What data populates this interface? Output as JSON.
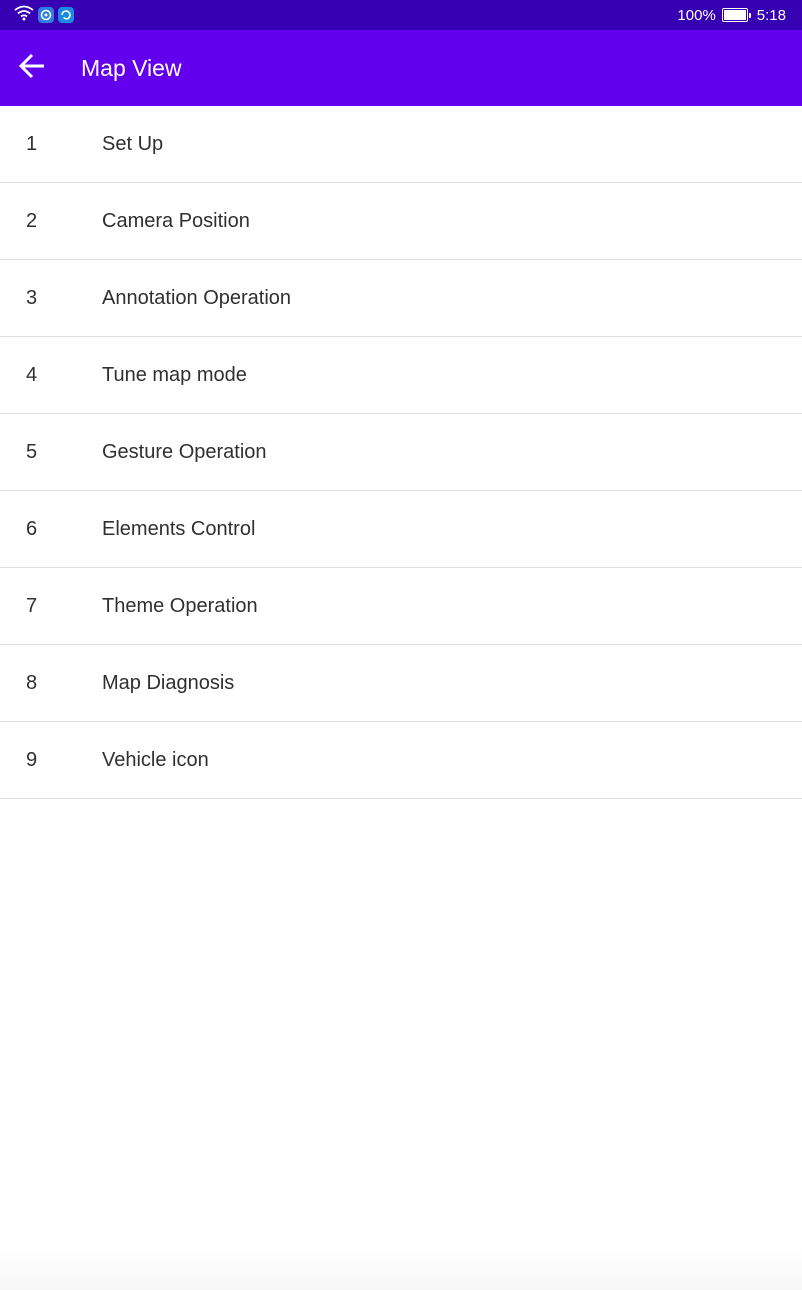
{
  "status_bar": {
    "battery": "100%",
    "time": "5:18",
    "icons": [
      "wifi-icon",
      "app-notification-icon",
      "app-notification-icon"
    ]
  },
  "app_bar": {
    "back_icon": "arrow-left-icon",
    "title": "Map View"
  },
  "colors": {
    "status_bar": "#3700b3",
    "app_bar": "#6200ee",
    "divider": "#dedede",
    "text": "#303030"
  },
  "items": [
    {
      "num": "1",
      "label": "Set Up"
    },
    {
      "num": "2",
      "label": "Camera Position"
    },
    {
      "num": "3",
      "label": "Annotation Operation"
    },
    {
      "num": "4",
      "label": "Tune map mode"
    },
    {
      "num": "5",
      "label": "Gesture Operation"
    },
    {
      "num": "6",
      "label": "Elements Control"
    },
    {
      "num": "7",
      "label": "Theme Operation"
    },
    {
      "num": "8",
      "label": "Map Diagnosis"
    },
    {
      "num": "9",
      "label": "Vehicle icon"
    }
  ]
}
